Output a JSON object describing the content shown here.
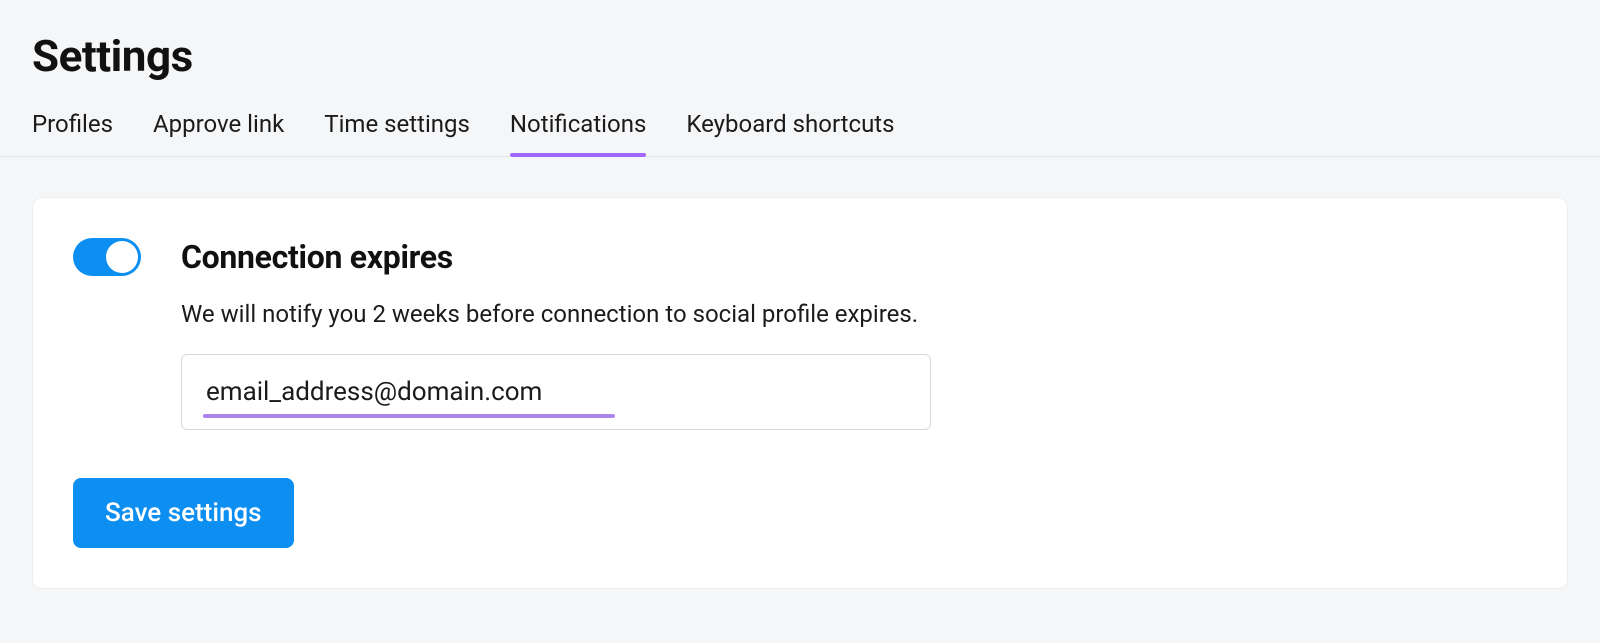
{
  "header": {
    "title": "Settings"
  },
  "tabs": [
    {
      "label": "Profiles",
      "active": false
    },
    {
      "label": "Approve link",
      "active": false
    },
    {
      "label": "Time settings",
      "active": false
    },
    {
      "label": "Notifications",
      "active": true
    },
    {
      "label": "Keyboard shortcuts",
      "active": false
    }
  ],
  "notifications": {
    "connection_expires": {
      "toggle_on": true,
      "title": "Connection expires",
      "description": "We will notify you 2 weeks before connection to social profile expires.",
      "email_value": "email_address@domain.com"
    },
    "save_label": "Save settings"
  }
}
